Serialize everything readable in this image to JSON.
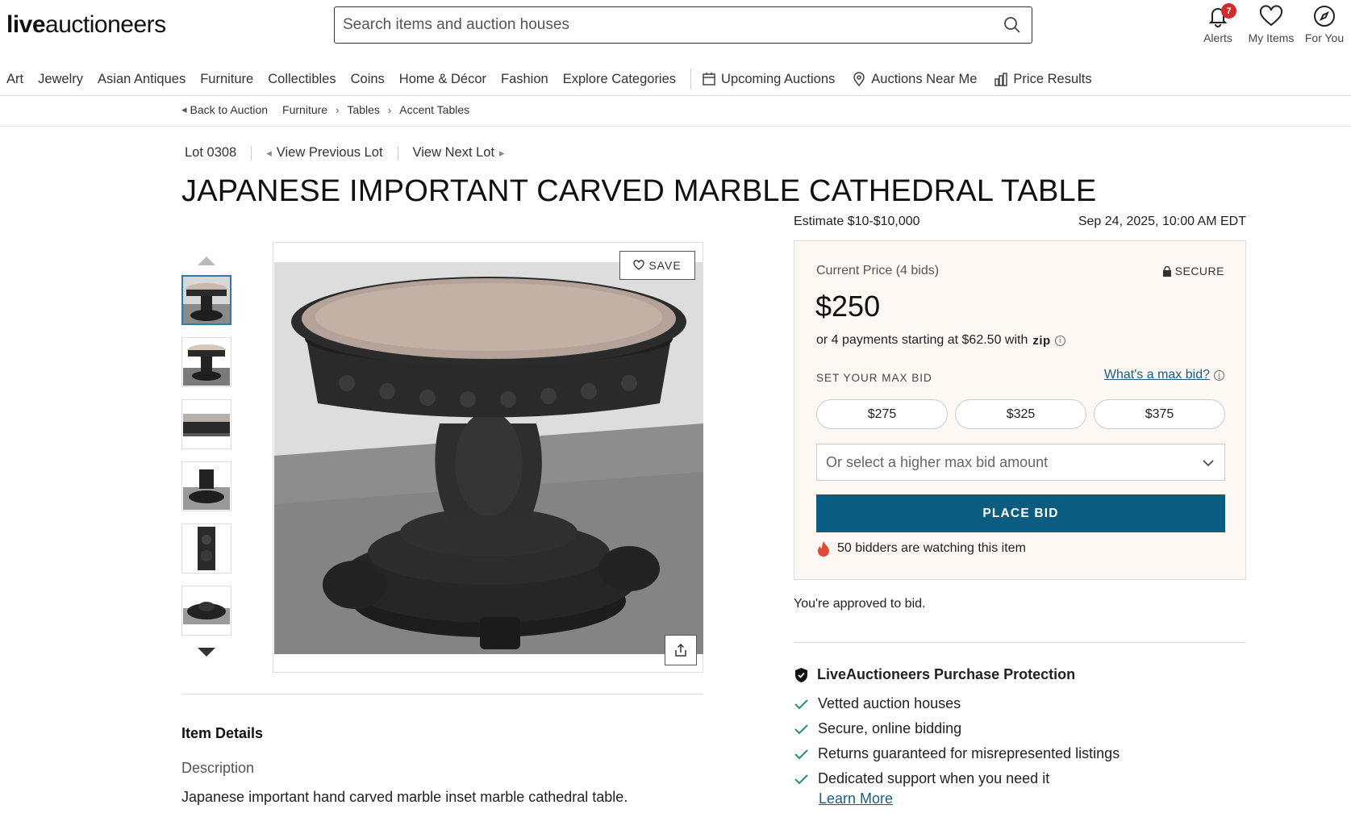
{
  "header": {
    "logo_bold": "live",
    "logo_rest": "auctioneers",
    "search_placeholder": "Search items and auction houses",
    "alerts_label": "Alerts",
    "alerts_count": "7",
    "my_items_label": "My Items",
    "for_you_label": "For You"
  },
  "categories": [
    "Art",
    "Jewelry",
    "Asian Antiques",
    "Furniture",
    "Collectibles",
    "Coins",
    "Home & Décor",
    "Fashion",
    "Explore Categories"
  ],
  "nav_links": {
    "upcoming": "Upcoming Auctions",
    "near_me": "Auctions Near Me",
    "price_results": "Price Results"
  },
  "breadcrumb": {
    "back": "Back to Auction",
    "items": [
      "Furniture",
      "Tables",
      "Accent Tables"
    ]
  },
  "lot": {
    "number": "Lot 0308",
    "prev": "View Previous Lot",
    "next": "View Next Lot",
    "title": "JAPANESE IMPORTANT CARVED MARBLE CATHEDRAL TABLE",
    "estimate": "Estimate $10-$10,000",
    "date": "Sep 24, 2025, 10:00 AM EDT"
  },
  "gallery": {
    "save_label": "SAVE",
    "thumb_count": 6,
    "active_thumb": 0
  },
  "bid": {
    "current_label": "Current Price (4 bids)",
    "secure_label": "SECURE",
    "price": "$250",
    "payments": "or 4 payments starting at $62.50 with",
    "zip_logo": "zip",
    "set_max_label": "SET YOUR MAX BID",
    "whats_max": "What's a max bid?",
    "options": [
      "$275",
      "$325",
      "$375"
    ],
    "select_placeholder": "Or select a higher max bid amount",
    "place_bid": "PLACE BID",
    "watching": "50 bidders are watching this item",
    "approved": "You're approved to bid."
  },
  "protection": {
    "title": "LiveAuctioneers Purchase Protection",
    "items": [
      "Vetted auction houses",
      "Secure, online bidding",
      "Returns guaranteed for misrepresented listings",
      "Dedicated support when you need it"
    ],
    "learn_more": "Learn More"
  },
  "details": {
    "heading": "Item Details",
    "desc_label": "Description",
    "desc_text": "Japanese important hand carved marble inset marble cathedral table."
  },
  "colors": {
    "accent": "#0a5c80",
    "link": "#1c5d80",
    "badge": "#d12b2b",
    "bidbox_bg": "#fdf8f4"
  }
}
